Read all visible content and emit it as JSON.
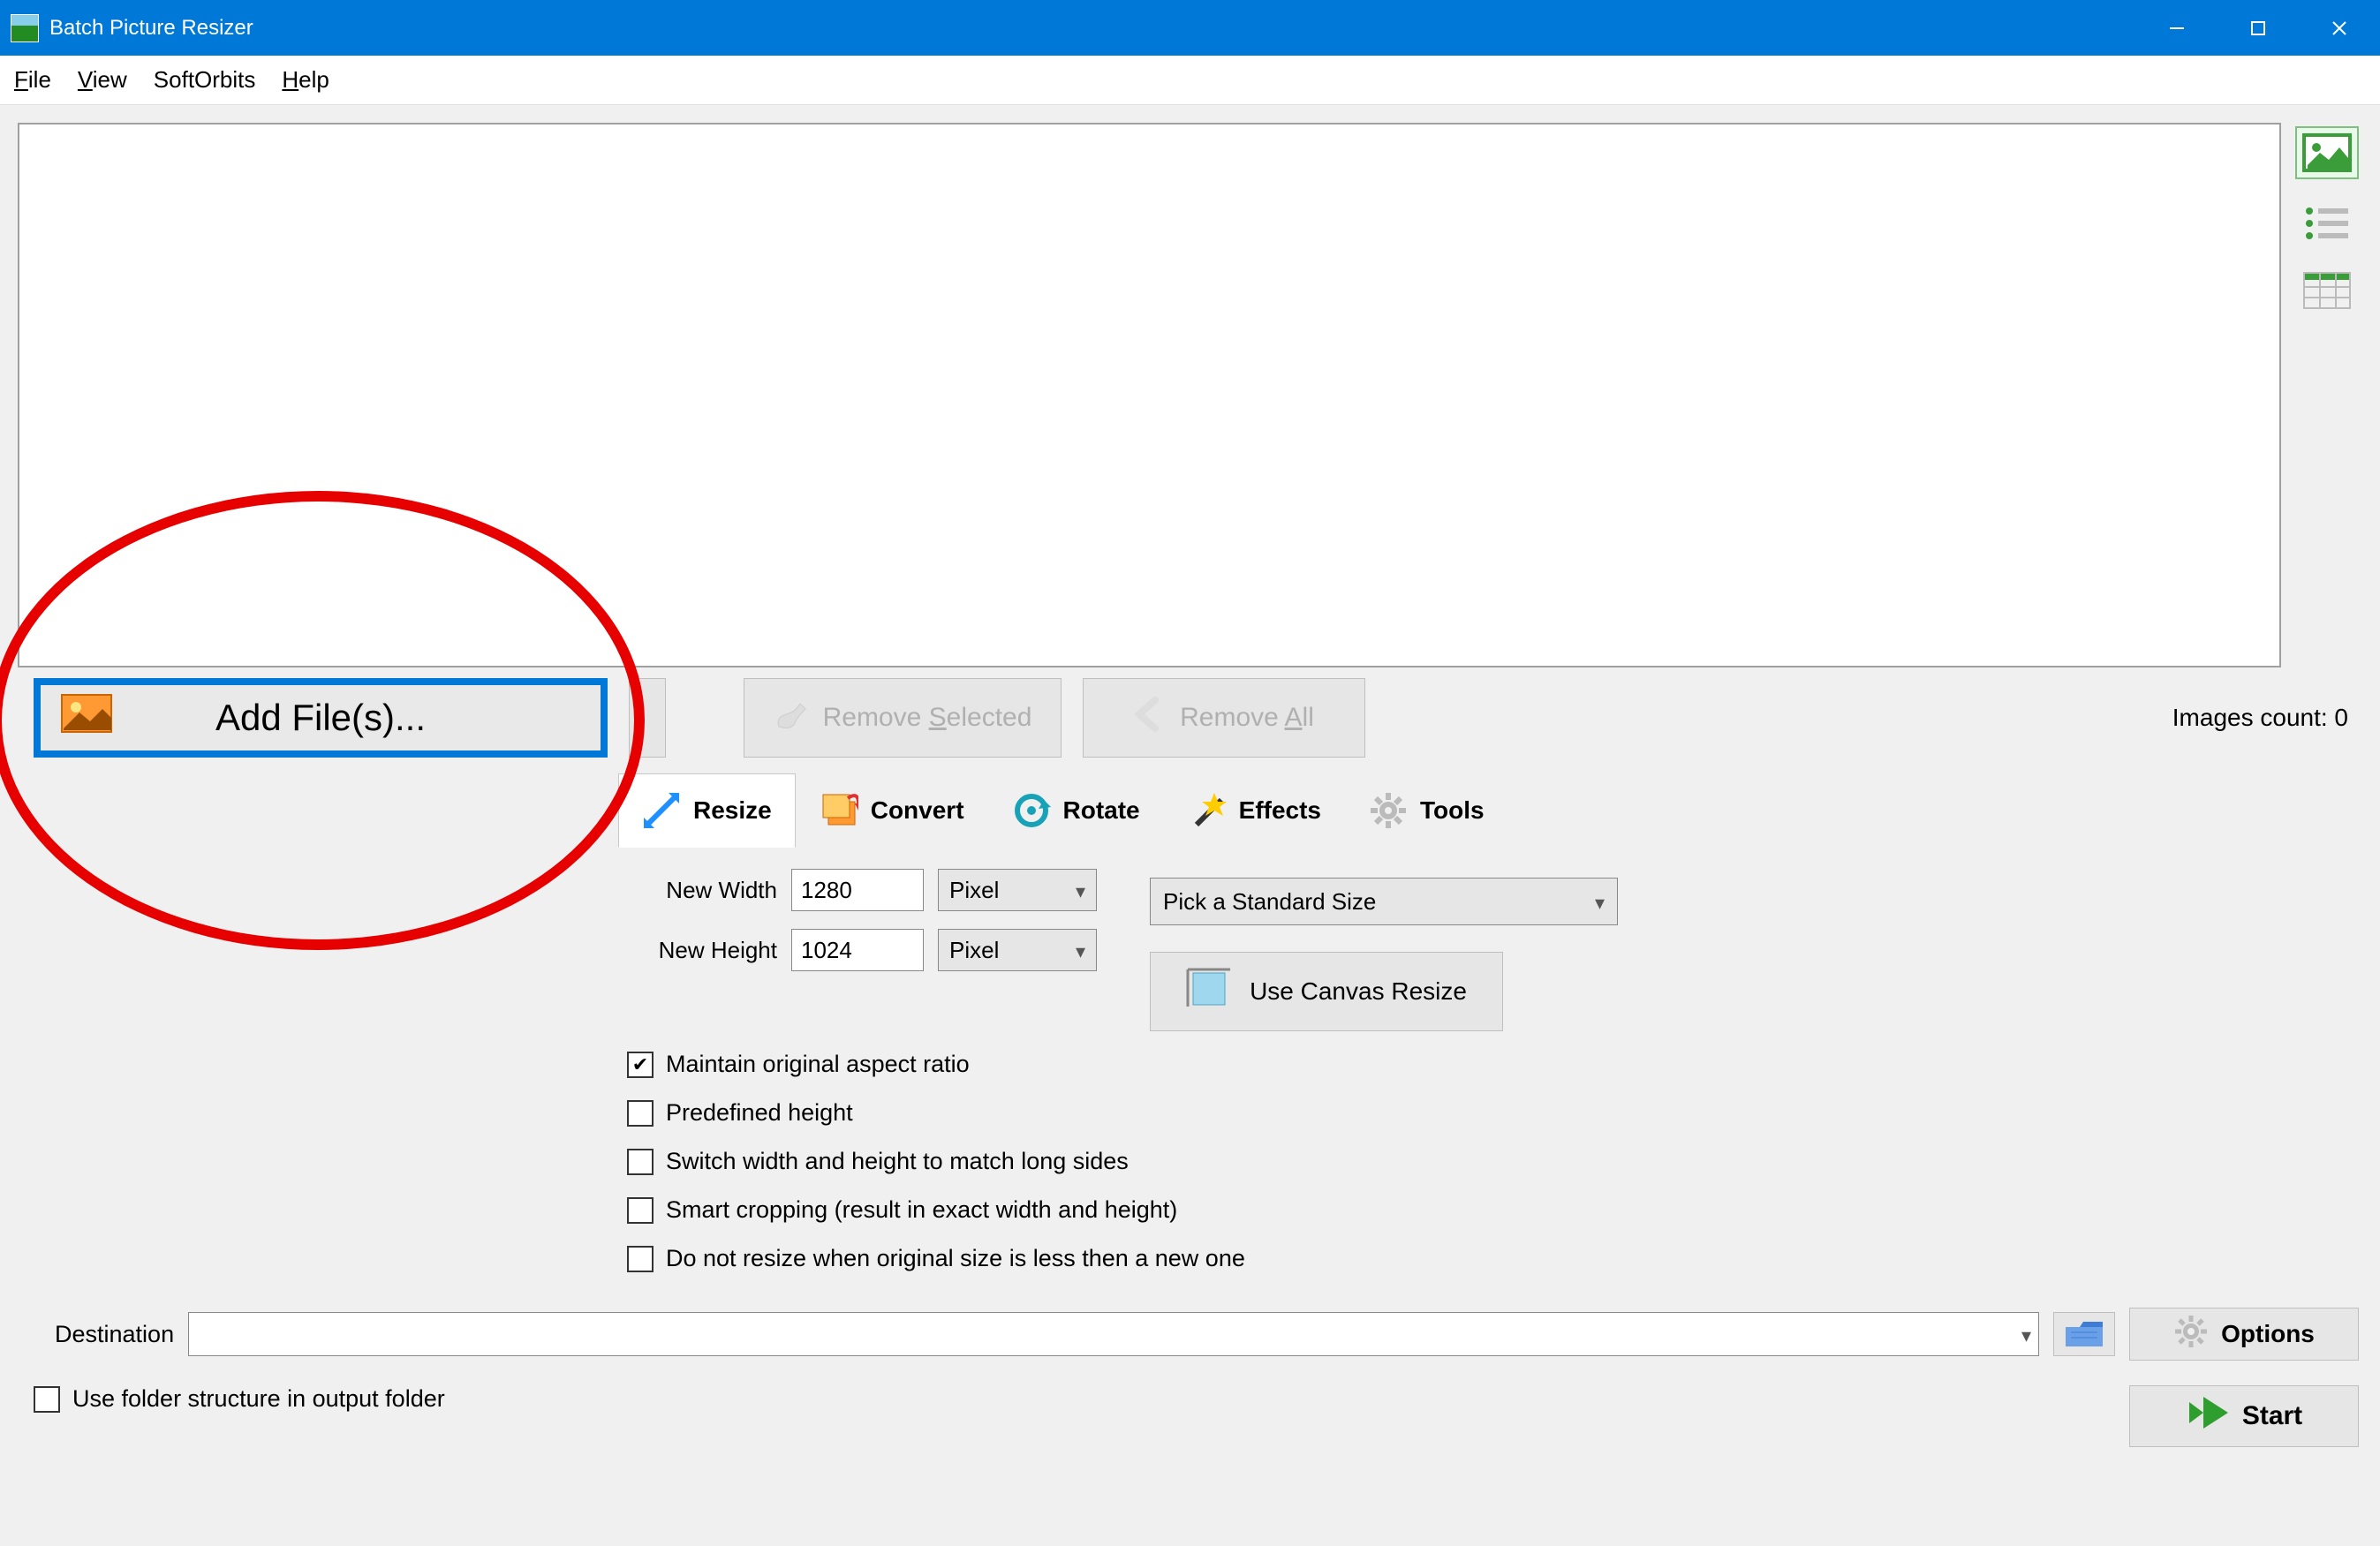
{
  "window": {
    "title": "Batch Picture Resizer"
  },
  "menu": {
    "file": "File",
    "view": "View",
    "softorbits": "SoftOrbits",
    "help": "Help"
  },
  "toolbar": {
    "add_files": "Add File(s)...",
    "remove_selected_pre": "Remove ",
    "remove_selected_ul": "S",
    "remove_selected_post": "elected",
    "remove_all_pre": "Remove ",
    "remove_all_ul": "A",
    "remove_all_post": "ll",
    "images_count": "Images count: 0"
  },
  "tabs": {
    "resize": "Resize",
    "convert": "Convert",
    "rotate": "Rotate",
    "effects": "Effects",
    "tools": "Tools"
  },
  "resize": {
    "width_label": "New Width",
    "width_value": "1280",
    "width_unit": "Pixel",
    "height_label": "New Height",
    "height_value": "1024",
    "height_unit": "Pixel",
    "std_size": "Pick a Standard Size",
    "canvas_btn": "Use Canvas Resize",
    "chk_aspect": "Maintain original aspect ratio",
    "chk_predef": "Predefined height",
    "chk_switch": "Switch width and height to match long sides",
    "chk_smart": "Smart cropping (result in exact width and height)",
    "chk_noresize": "Do not resize when original size is less then a new one"
  },
  "dest": {
    "label": "Destination",
    "options_btn": "Options"
  },
  "bottom": {
    "chk_folder_struct": "Use folder structure in output folder",
    "start_btn": "Start"
  }
}
